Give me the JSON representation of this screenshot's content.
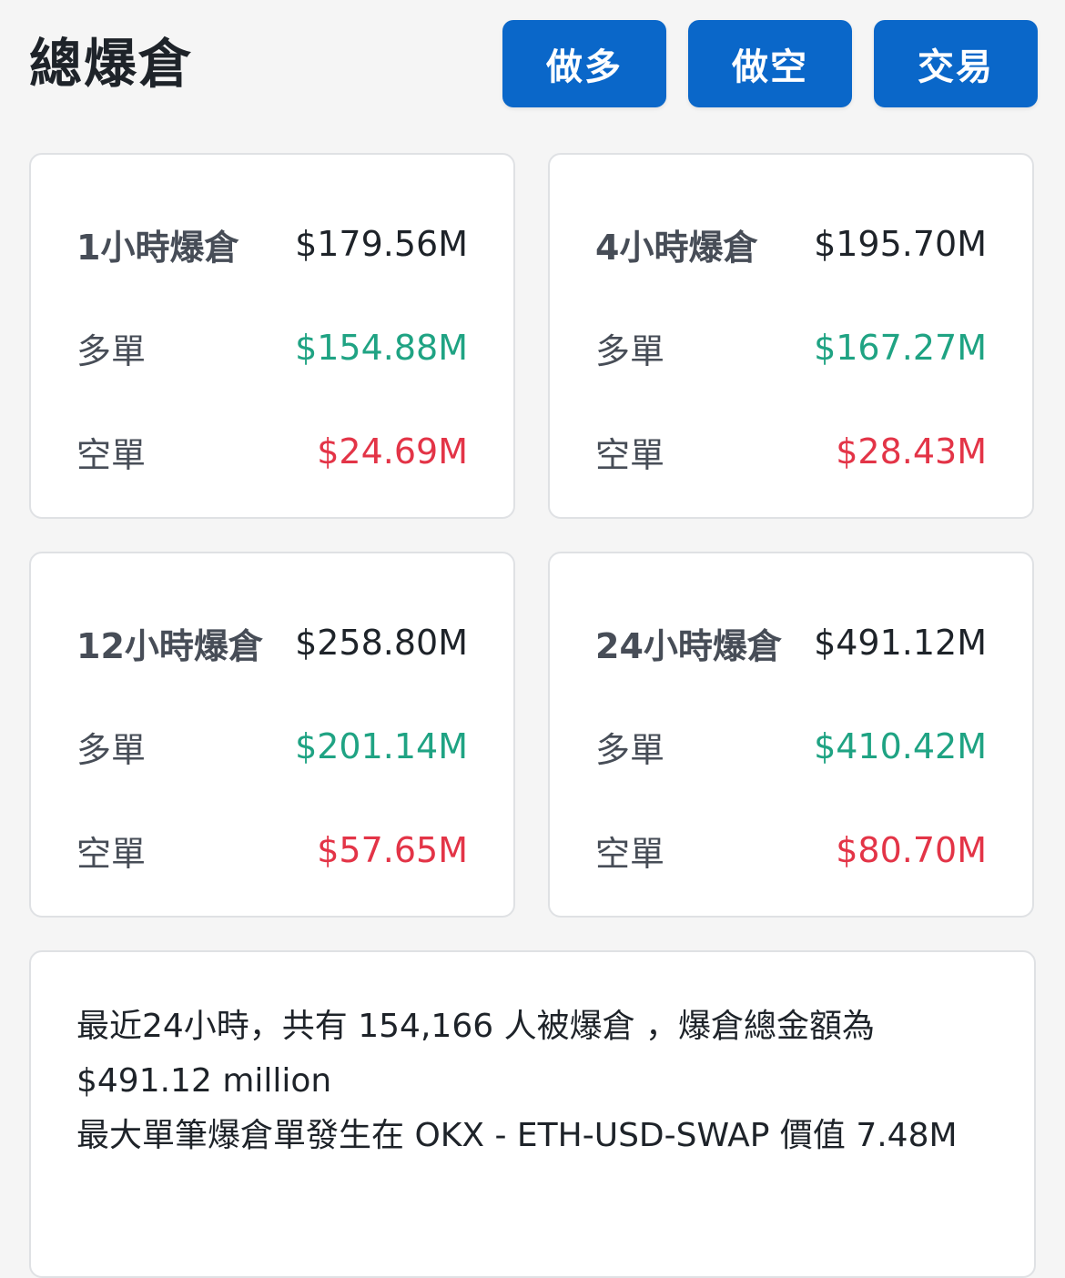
{
  "header": {
    "title": "總爆倉",
    "buttons": {
      "long": "做多",
      "short": "做空",
      "trade": "交易"
    }
  },
  "cards": [
    {
      "period_label": "1小時爆倉",
      "total": "$179.56M",
      "long_label": "多單",
      "long_value": "$154.88M",
      "short_label": "空單",
      "short_value": "$24.69M"
    },
    {
      "period_label": "4小時爆倉",
      "total": "$195.70M",
      "long_label": "多單",
      "long_value": "$167.27M",
      "short_label": "空單",
      "short_value": "$28.43M"
    },
    {
      "period_label": "12小時爆倉",
      "total": "$258.80M",
      "long_label": "多單",
      "long_value": "$201.14M",
      "short_label": "空單",
      "short_value": "$57.65M"
    },
    {
      "period_label": "24小時爆倉",
      "total": "$491.12M",
      "long_label": "多單",
      "long_value": "$410.42M",
      "short_label": "空單",
      "short_value": "$80.70M"
    }
  ],
  "summary": {
    "line1": "最近24小時，共有 154,166 人被爆倉 ，爆倉總金額為 $491.12 million",
    "line2": "最大單筆爆倉單發生在 OKX - ETH-USD-SWAP 價值 7.48M"
  },
  "colors": {
    "accent_button": "#0a67c9",
    "long_green": "#1fa383",
    "short_red": "#e33447"
  }
}
